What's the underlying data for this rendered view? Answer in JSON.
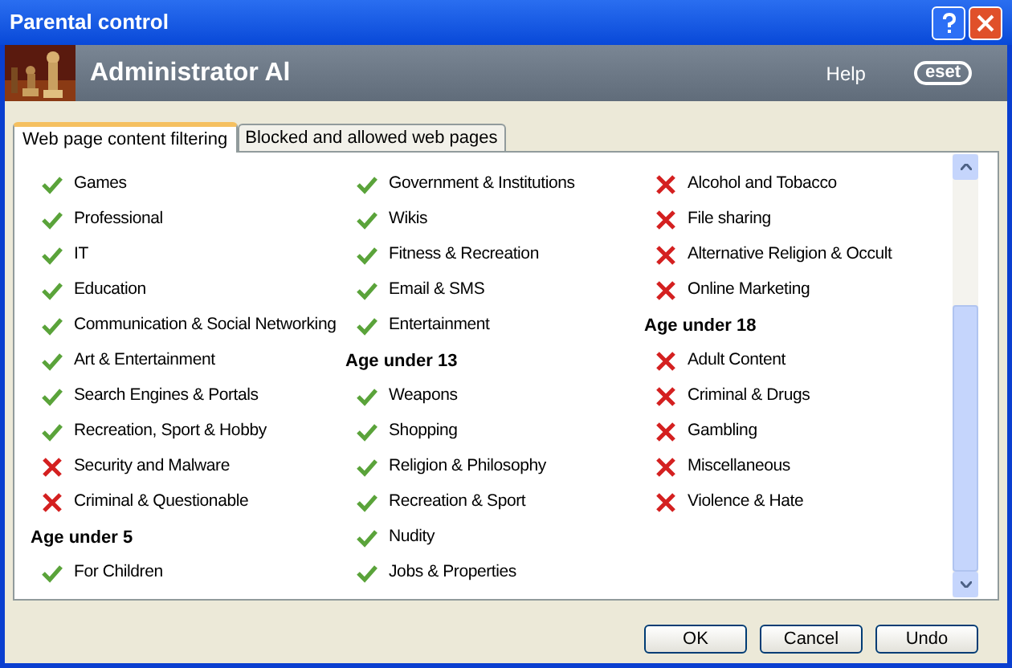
{
  "window": {
    "title": "Parental control"
  },
  "header": {
    "user": "Administrator Al",
    "help": "Help",
    "logo": "eset"
  },
  "tabs": [
    {
      "label": "Web page content filtering",
      "selected": true
    },
    {
      "label": "Blocked and allowed web pages",
      "selected": false
    }
  ],
  "columns": [
    {
      "items": [
        {
          "kind": "item",
          "label": "Games",
          "allowed": true
        },
        {
          "kind": "item",
          "label": "Professional",
          "allowed": true
        },
        {
          "kind": "item",
          "label": "IT",
          "allowed": true
        },
        {
          "kind": "item",
          "label": "Education",
          "allowed": true
        },
        {
          "kind": "item",
          "label": "Communication & Social Networking",
          "allowed": true
        },
        {
          "kind": "item",
          "label": "Art & Entertainment",
          "allowed": true
        },
        {
          "kind": "item",
          "label": "Search Engines & Portals",
          "allowed": true
        },
        {
          "kind": "item",
          "label": "Recreation, Sport & Hobby",
          "allowed": true
        },
        {
          "kind": "item",
          "label": "Security and Malware",
          "allowed": false
        },
        {
          "kind": "item",
          "label": "Criminal & Questionable",
          "allowed": false
        },
        {
          "kind": "heading",
          "label": "Age under 5"
        },
        {
          "kind": "item",
          "label": "For Children",
          "allowed": true
        }
      ]
    },
    {
      "items": [
        {
          "kind": "item",
          "label": "Government & Institutions",
          "allowed": true
        },
        {
          "kind": "item",
          "label": "Wikis",
          "allowed": true
        },
        {
          "kind": "item",
          "label": "Fitness & Recreation",
          "allowed": true
        },
        {
          "kind": "item",
          "label": "Email & SMS",
          "allowed": true
        },
        {
          "kind": "item",
          "label": "Entertainment",
          "allowed": true
        },
        {
          "kind": "heading",
          "label": "Age under 13"
        },
        {
          "kind": "item",
          "label": "Weapons",
          "allowed": true
        },
        {
          "kind": "item",
          "label": "Shopping",
          "allowed": true
        },
        {
          "kind": "item",
          "label": "Religion & Philosophy",
          "allowed": true
        },
        {
          "kind": "item",
          "label": "Recreation & Sport",
          "allowed": true
        },
        {
          "kind": "item",
          "label": "Nudity",
          "allowed": true
        },
        {
          "kind": "item",
          "label": "Jobs & Properties",
          "allowed": true
        }
      ]
    },
    {
      "items": [
        {
          "kind": "item",
          "label": "Alcohol and Tobacco",
          "allowed": false
        },
        {
          "kind": "item",
          "label": "File sharing",
          "allowed": false
        },
        {
          "kind": "item",
          "label": "Alternative Religion & Occult",
          "allowed": false
        },
        {
          "kind": "item",
          "label": "Online Marketing",
          "allowed": false
        },
        {
          "kind": "heading",
          "label": "Age under 18"
        },
        {
          "kind": "item",
          "label": "Adult Content",
          "allowed": false
        },
        {
          "kind": "item",
          "label": "Criminal & Drugs",
          "allowed": false
        },
        {
          "kind": "item",
          "label": "Gambling",
          "allowed": false
        },
        {
          "kind": "item",
          "label": "Miscellaneous",
          "allowed": false
        },
        {
          "kind": "item",
          "label": "Violence & Hate",
          "allowed": false
        }
      ]
    }
  ],
  "buttons": [
    "OK",
    "Cancel",
    "Undo"
  ]
}
